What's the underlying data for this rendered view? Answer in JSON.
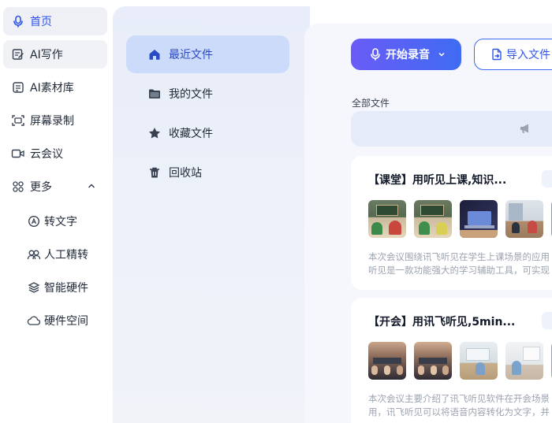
{
  "left_nav": {
    "items": [
      {
        "label": "首页",
        "icon": "mic-icon"
      },
      {
        "label": "AI写作",
        "icon": "edit-icon"
      },
      {
        "label": "AI素材库",
        "icon": "library-icon"
      },
      {
        "label": "屏幕录制",
        "icon": "screen-record-icon"
      },
      {
        "label": "云会议",
        "icon": "video-icon"
      },
      {
        "label": "更多",
        "icon": "grid-icon"
      }
    ],
    "sub_items": [
      {
        "label": "转文字",
        "icon": "transcribe-icon"
      },
      {
        "label": "人工精转",
        "icon": "people-icon"
      },
      {
        "label": "智能硬件",
        "icon": "layers-icon"
      },
      {
        "label": "硬件空间",
        "icon": "cloud-icon"
      }
    ]
  },
  "file_nav": {
    "items": [
      {
        "label": "最近文件",
        "icon": "home-icon"
      },
      {
        "label": "我的文件",
        "icon": "folder-icon"
      },
      {
        "label": "收藏文件",
        "icon": "star-icon"
      },
      {
        "label": "回收站",
        "icon": "trash-icon"
      }
    ]
  },
  "toolbar": {
    "record_label": "开始录音",
    "import_label": "导入文件"
  },
  "section": {
    "all_files_label": "全部文件"
  },
  "files": [
    {
      "title": "【课堂】用听见上课,知识...",
      "desc_line1": "本次会议围绕讯飞听见在学生上课场景的应用",
      "desc_line2": "听见是一款功能强大的学习辅助工具，可实现"
    },
    {
      "title": "【开会】用讯飞听见,5min...",
      "desc_line1": "本次会议主要介绍了讯飞听见软件在开会场景",
      "desc_line2": "用，讯飞听见可以将语音内容转化为文字，并"
    }
  ],
  "colors": {
    "accent": "#2f54eb",
    "record_gradient_start": "#6a5cf6",
    "record_gradient_end": "#3f6bf3",
    "active_file_bg": "#cddbfa"
  }
}
